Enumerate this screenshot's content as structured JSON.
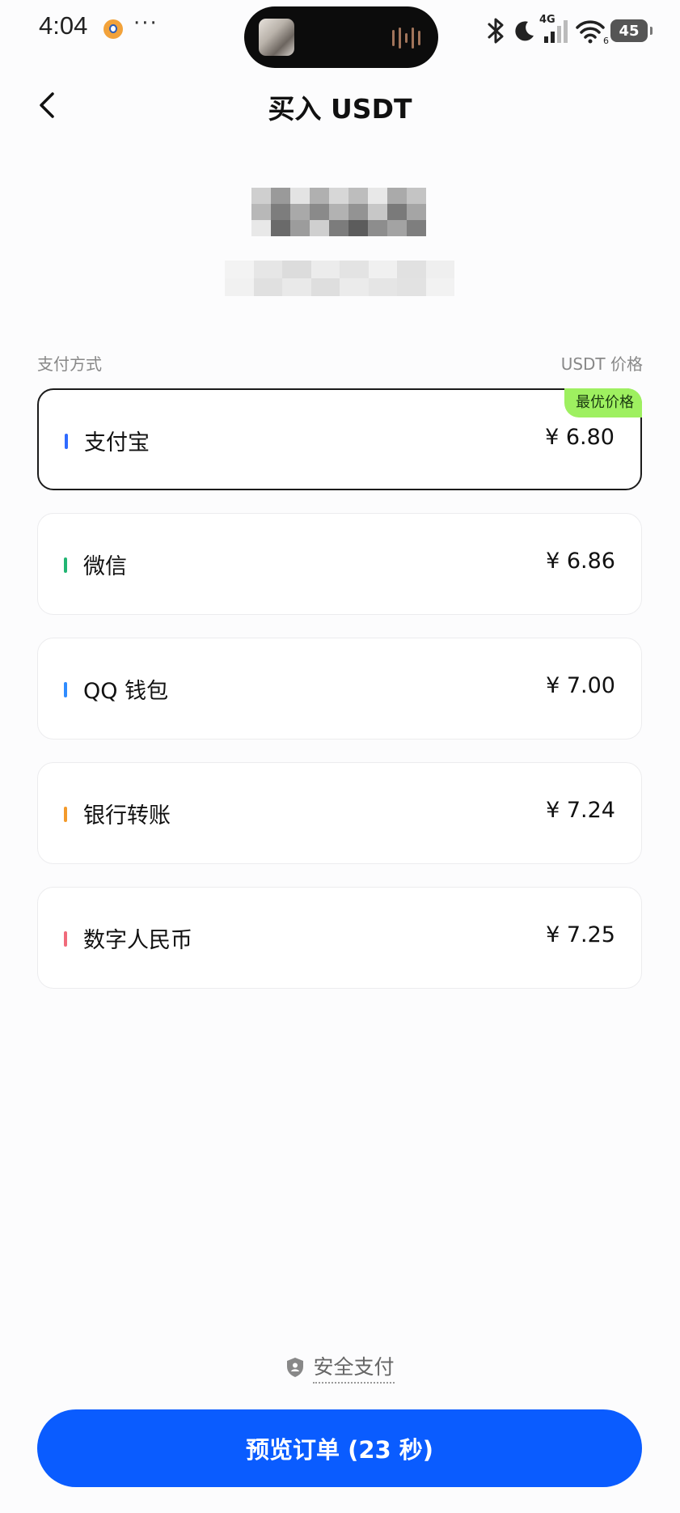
{
  "status_bar": {
    "time": "4:04",
    "more": "···",
    "network": "4G",
    "wifi_sub": "6",
    "battery": "45"
  },
  "header": {
    "title": "买入 USDT"
  },
  "section": {
    "left_label": "支付方式",
    "right_label": "USDT 价格"
  },
  "payment_methods": [
    {
      "name": "支付宝",
      "price": "¥ 6.80",
      "badge": "最优价格",
      "color": "#2f6bff",
      "selected": true
    },
    {
      "name": "微信",
      "price": "¥ 6.86",
      "color": "#22b573"
    },
    {
      "name": "QQ 钱包",
      "price": "¥ 7.00",
      "color": "#2f8cff"
    },
    {
      "name": "银行转账",
      "price": "¥ 7.24",
      "color": "#f39a2b"
    },
    {
      "name": "数字人民币",
      "price": "¥ 7.25",
      "color": "#f06b7b"
    }
  ],
  "secure": {
    "label": "安全支付"
  },
  "footer": {
    "button_label": "预览订单 (23 秒)"
  },
  "colors": {
    "primary": "#0a5cff",
    "badge": "#9ef060"
  }
}
